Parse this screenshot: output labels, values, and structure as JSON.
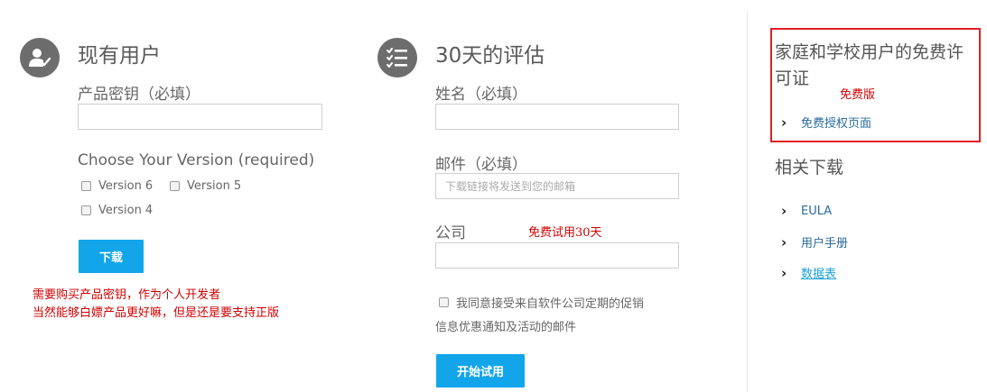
{
  "existing_user": {
    "title": "现有用户",
    "product_key_label": "产品密钥（必填）",
    "product_key_value": "",
    "version_label": "Choose Your Version (required)",
    "versions": [
      "Version 6",
      "Version 5",
      "Version 4"
    ],
    "download_button": "下载",
    "note_line1": "需要购买产品密钥，作为个人开发者",
    "note_line2": "当然能够白嫖产品更好嘛，但是还是要支持正版"
  },
  "trial": {
    "title": "30天的评估",
    "name_label": "姓名（必填）",
    "name_value": "",
    "email_label": "邮件（必填）",
    "email_placeholder": "下载链接将发送到您的邮箱",
    "company_label": "公司",
    "company_note": "免费试用30天",
    "company_value": "",
    "consent_line1": "我同意接受来自软件公司定期的促销",
    "consent_line2": "信息优惠通知及活动的邮件",
    "start_button": "开始试用"
  },
  "sidebar": {
    "free_license_title_line1": "家庭和学校用户的免费许",
    "free_license_title_line2": "可证",
    "free_note": "免费版",
    "free_link": "免费授权页面",
    "related_title": "相关下载",
    "related_links": [
      "EULA",
      "用户手册",
      "数据表"
    ]
  },
  "colors": {
    "accent": "#12a5e9",
    "annotation_red": "#d00000",
    "highlight_box": "#e01f26",
    "icon_gray": "#6d6d6d"
  }
}
